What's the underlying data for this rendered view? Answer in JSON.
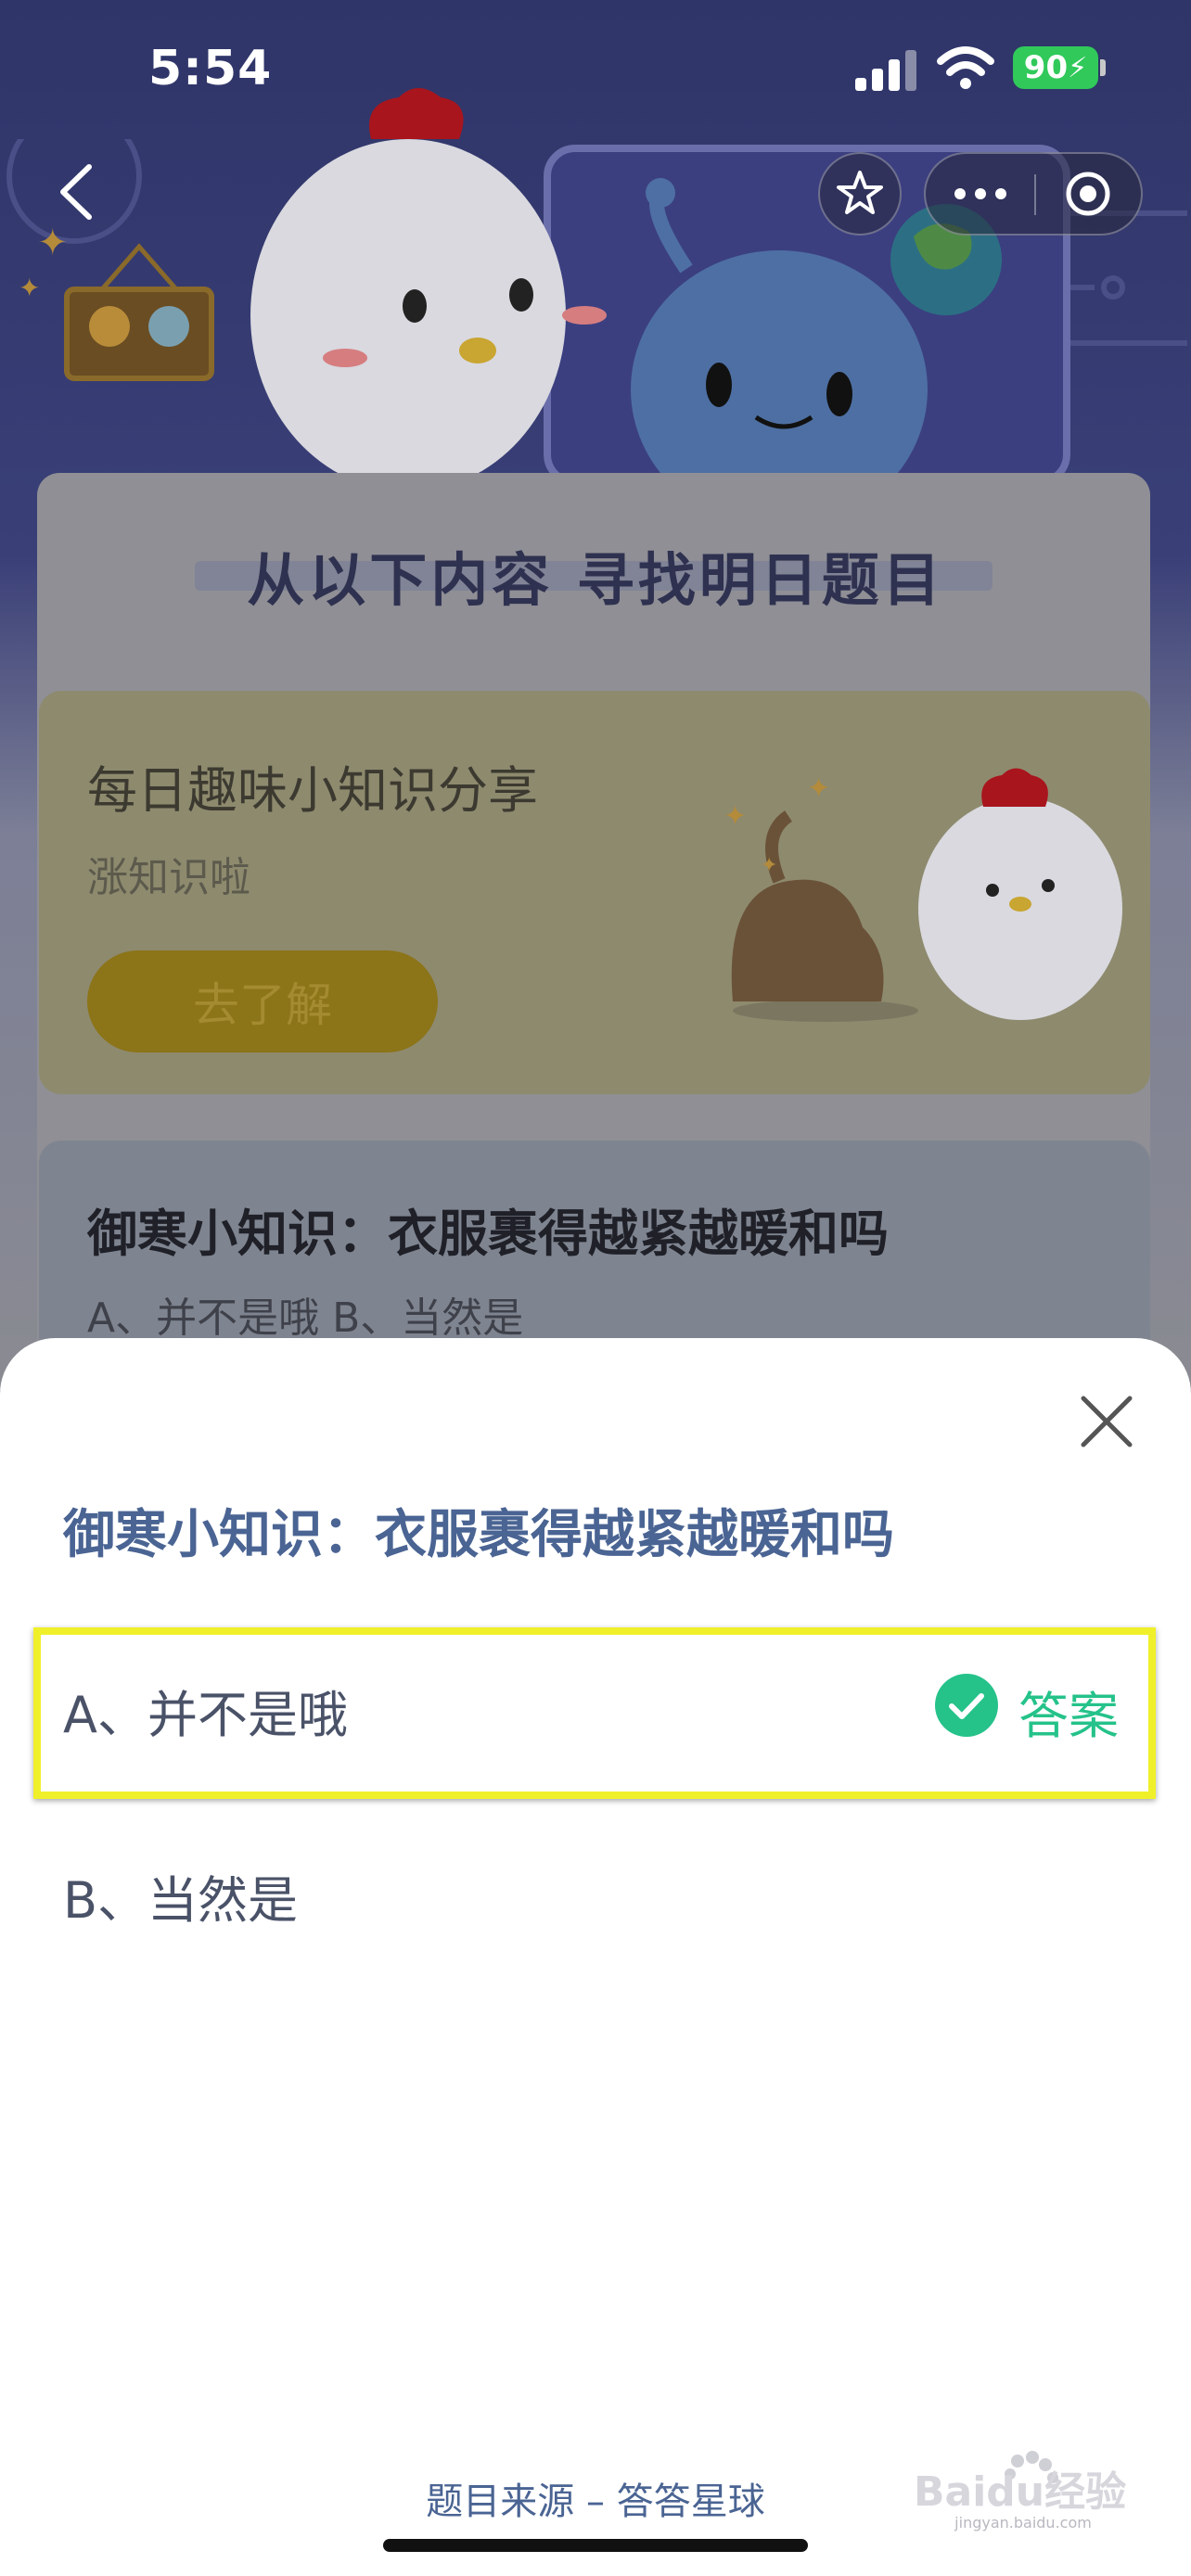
{
  "status_bar": {
    "time": "5:54",
    "battery": "90",
    "battery_color": "#30c95a"
  },
  "nav": {
    "icons": [
      "back-icon",
      "star-icon",
      "more-icon",
      "target-icon"
    ]
  },
  "background": {
    "heading": "从以下内容  寻找明日题目",
    "card1": {
      "title": "每日趣味小知识分享",
      "subtitle": "涨知识啦",
      "button": "去了解"
    },
    "card2": {
      "title": "御寒小知识：衣服裹得越紧越暖和吗",
      "options": "A、并不是哦     B、当然是"
    }
  },
  "sheet": {
    "question": "御寒小知识：衣服裹得越紧越暖和吗",
    "options": [
      {
        "label": "A、并不是哦",
        "is_answer": true,
        "tag": "答案"
      },
      {
        "label": "B、当然是",
        "is_answer": false
      }
    ],
    "highlight_color": "#f0f02a",
    "answer_color": "#25c28a",
    "source": "题目来源 – 答答星球"
  },
  "watermark": {
    "text": "Baidu经验",
    "domain": "jingyan.baidu.com"
  }
}
